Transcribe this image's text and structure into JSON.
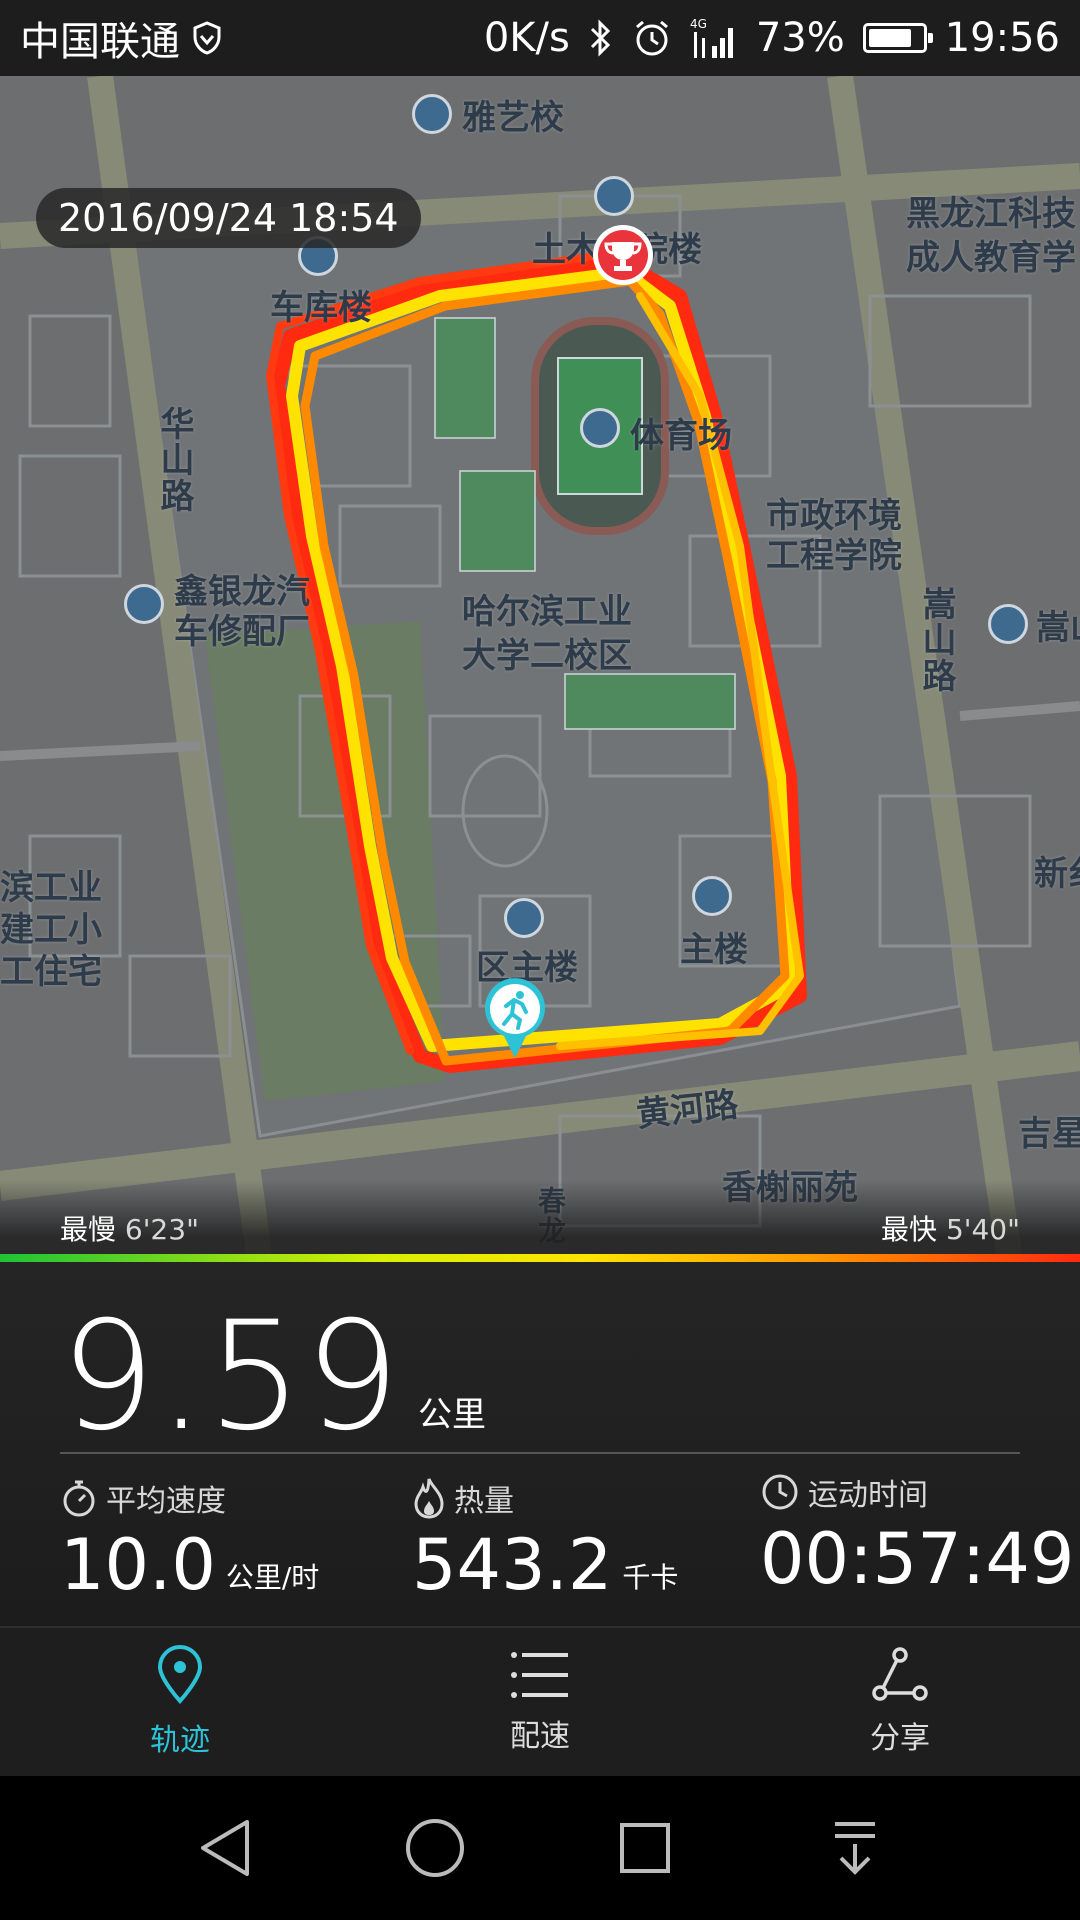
{
  "statusbar": {
    "carrier": "中国联通",
    "net_speed": "0K/s",
    "network": "4G LTE",
    "battery": "73%",
    "battery_level": 0.73,
    "time": "19:56"
  },
  "map": {
    "datetime": "2016/09/24 18:54",
    "labels": {
      "yayixiao": "雅艺校",
      "tumu": "土木学院楼",
      "cheku": "车库楼",
      "huashan": "华山路",
      "tiyuchang": "体育场",
      "shizheng1": "市政环境",
      "shizheng2": "工程学院",
      "heilongjiang1": "黑龙江科技",
      "heilongjiang2": "成人教育学",
      "xinyin1": "鑫银龙汽",
      "xinyin2": "车修配厂",
      "hgd1": "哈尔滨工业",
      "hgd2": "大学二校区",
      "songshan": "嵩山路",
      "song_right": "嵩山",
      "left1": "滨工业",
      "left2": "建工小",
      "left3": "工住宅",
      "quzhulou": "区主楼",
      "zhulou": "主楼",
      "huanghe": "黄河路",
      "xiangxie": "香榭丽苑",
      "jixing": "吉星",
      "xin": "新纟",
      "chunlong": "春龙"
    },
    "slowest_label": "最慢",
    "slowest_value": "6'23\"",
    "fastest_label": "最快",
    "fastest_value": "5'40\""
  },
  "stats": {
    "distance_value": "9.59",
    "distance_unit": "公里",
    "avg_speed_label": "平均速度",
    "avg_speed_value": "10.0",
    "avg_speed_unit": "公里/时",
    "calories_label": "热量",
    "calories_value": "543.2",
    "calories_unit": "千卡",
    "duration_label": "运动时间",
    "duration_value": "00:57:49"
  },
  "tabs": [
    {
      "label": "轨迹",
      "icon": "location-pin-icon",
      "active": true
    },
    {
      "label": "配速",
      "icon": "list-icon",
      "active": false
    },
    {
      "label": "分享",
      "icon": "share-icon",
      "active": false
    }
  ],
  "colors": {
    "accent": "#2ec2d6",
    "route_slow": "#ff2a10",
    "route_mid": "#ff9a00",
    "route_fast": "#ffe200"
  }
}
